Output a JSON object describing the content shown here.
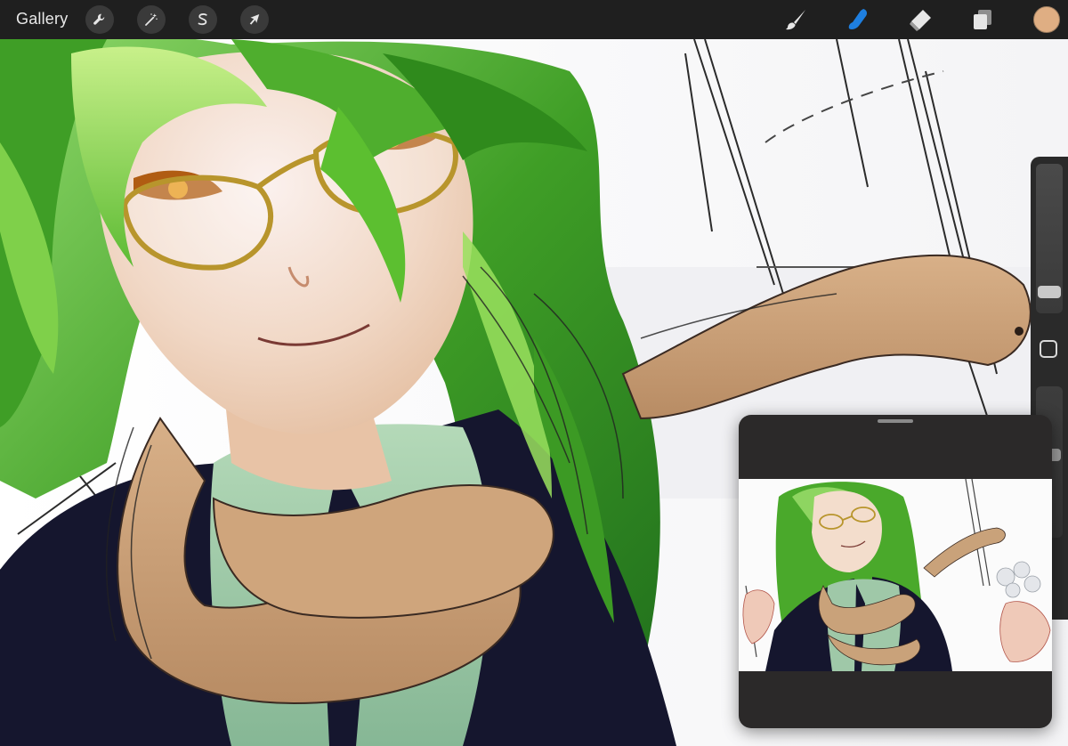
{
  "app": {
    "gallery_label": "Gallery"
  },
  "toolbar": {
    "left_tools": [
      {
        "name": "actions",
        "icon": "wrench-icon"
      },
      {
        "name": "adjustments",
        "icon": "magic-wand-icon"
      },
      {
        "name": "selection",
        "icon": "selection-s-icon"
      },
      {
        "name": "transform",
        "icon": "arrow-cursor-icon"
      }
    ],
    "right_tools": [
      {
        "name": "brush",
        "icon": "brush-icon",
        "active": false
      },
      {
        "name": "smudge",
        "icon": "smudge-finger-icon",
        "active": true
      },
      {
        "name": "eraser",
        "icon": "eraser-icon",
        "active": false
      },
      {
        "name": "layers",
        "icon": "layers-icon",
        "active": false
      }
    ],
    "current_color": "#dfae83"
  },
  "sidebar": {
    "brush_size_level": 0.9,
    "opacity_level": 0.45,
    "modify_icon": "square-icon"
  },
  "colors": {
    "toolbar_bg": "#1f1f1f",
    "active_tool": "#1e7fe0",
    "hair_green": "#4fae2e",
    "skin": "#f1d8c4",
    "snake_tan": "#c9a27a",
    "shirt_mint": "#9fc8a8",
    "vest_navy": "#15162e"
  }
}
